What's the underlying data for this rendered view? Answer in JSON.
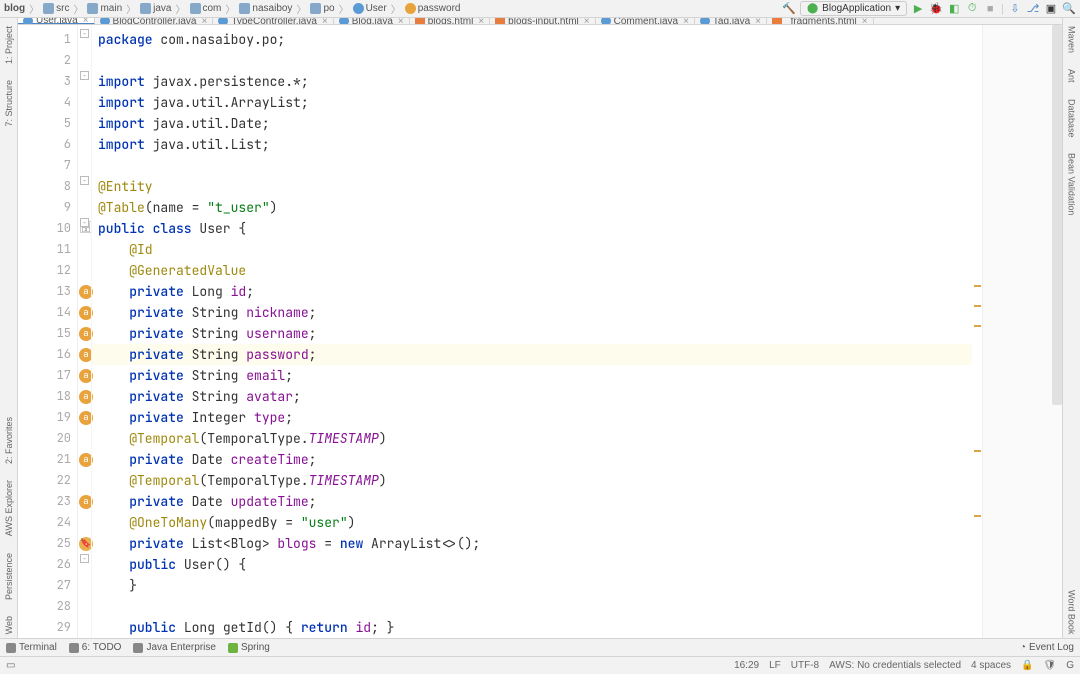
{
  "breadcrumb": [
    "blog",
    "src",
    "main",
    "java",
    "com",
    "nasaiboy",
    "po"
  ],
  "breadcrumb_class": "User",
  "breadcrumb_field": "password",
  "run_config": "BlogApplication",
  "tabs": [
    {
      "label": "User.java",
      "icon": "c",
      "active": true
    },
    {
      "label": "BlogController.java",
      "icon": "c"
    },
    {
      "label": "TypeController.java",
      "icon": "c"
    },
    {
      "label": "Blog.java",
      "icon": "c"
    },
    {
      "label": "blogs.html",
      "icon": "h"
    },
    {
      "label": "blogs-input.html",
      "icon": "h"
    },
    {
      "label": "Comment.java",
      "icon": "c"
    },
    {
      "label": "Tag.java",
      "icon": "c"
    },
    {
      "label": "_fragments.html",
      "icon": "h"
    }
  ],
  "code_lines": [
    {
      "n": 1,
      "html": "<span class='kw'>package</span> com.nasaiboy.po;"
    },
    {
      "n": 2,
      "html": ""
    },
    {
      "n": 3,
      "html": "<span class='kw'>import</span> javax.persistence.*;"
    },
    {
      "n": 4,
      "html": "<span class='kw'>import</span> java.util.ArrayList;"
    },
    {
      "n": 5,
      "html": "<span class='kw'>import</span> java.util.Date;"
    },
    {
      "n": 6,
      "html": "<span class='kw'>import</span> java.util.List;"
    },
    {
      "n": 7,
      "html": ""
    },
    {
      "n": 8,
      "html": "<span class='ann'>@Entity</span>"
    },
    {
      "n": 9,
      "html": "<span class='ann'>@Table</span>(name = <span class='str'>\"t_user\"</span>)"
    },
    {
      "n": 10,
      "html": "<span class='kw'>public class</span> User {",
      "badge": "db"
    },
    {
      "n": 11,
      "html": "    <span class='ann'>@Id</span>"
    },
    {
      "n": 12,
      "html": "    <span class='ann'>@GeneratedValue</span>"
    },
    {
      "n": 13,
      "html": "    <span class='kw'>private</span> Long <span class='fld'>id</span>;",
      "badge": "a"
    },
    {
      "n": 14,
      "html": "    <span class='kw'>private</span> String <span class='fld'>nickname</span>;",
      "badge": "a"
    },
    {
      "n": 15,
      "html": "    <span class='kw'>private</span> String <span class='fld'>username</span>;",
      "badge": "a"
    },
    {
      "n": 16,
      "html": "    <span class='kw'>private</span> String <span class='fld'>password</span>;",
      "badge": "a",
      "hl": true
    },
    {
      "n": 17,
      "html": "    <span class='kw'>private</span> String <span class='fld'>email</span>;",
      "badge": "a"
    },
    {
      "n": 18,
      "html": "    <span class='kw'>private</span> String <span class='fld'>avatar</span>;",
      "badge": "a"
    },
    {
      "n": 19,
      "html": "    <span class='kw'>private</span> Integer <span class='fld'>type</span>;",
      "badge": "a"
    },
    {
      "n": 20,
      "html": "    <span class='ann'>@Temporal</span>(TemporalType.<span class='italic'>TIMESTAMP</span>)"
    },
    {
      "n": 21,
      "html": "    <span class='kw'>private</span> Date <span class='fld'>createTime</span>;",
      "badge": "a"
    },
    {
      "n": 22,
      "html": "    <span class='ann'>@Temporal</span>(TemporalType.<span class='italic'>TIMESTAMP</span>)"
    },
    {
      "n": 23,
      "html": "    <span class='kw'>private</span> Date <span class='fld'>updateTime</span>;",
      "badge": "a"
    },
    {
      "n": 24,
      "html": "    <span class='ann'>@OneToMany</span>(mappedBy = <span class='str'>\"user\"</span>)"
    },
    {
      "n": 25,
      "html": "    <span class='kw'>private</span> List&lt;Blog&gt; <span class='fld'>blogs</span> = <span class='kw'>new</span> ArrayList&lt;&gt;();",
      "badge": "tag"
    },
    {
      "n": 26,
      "html": "    <span class='kw'>public</span> User() {"
    },
    {
      "n": 27,
      "html": "    }"
    },
    {
      "n": 28,
      "html": ""
    },
    {
      "n": 29,
      "html": "    <span class='kw'>public</span> Long getId() { <span class='kw'>return</span> <span class='fld'>id</span>; }"
    }
  ],
  "left_rail": [
    "1: Project",
    "7: Structure",
    "2: Favorites",
    "AWS Explorer",
    "Persistence",
    "Web"
  ],
  "right_rail": [
    "Maven",
    "Ant",
    "Database",
    "Bean Validation",
    "Word Book"
  ],
  "bottom_tools": {
    "terminal": "Terminal",
    "todo": "6: TODO",
    "java_ee": "Java Enterprise",
    "spring": "Spring",
    "event_log": "Event Log"
  },
  "status": {
    "cursor": "16:29",
    "eol": "LF",
    "encoding": "UTF-8",
    "aws": "AWS: No credentials selected",
    "indent": "4 spaces"
  },
  "markers": [
    260,
    280,
    300,
    425,
    490
  ]
}
